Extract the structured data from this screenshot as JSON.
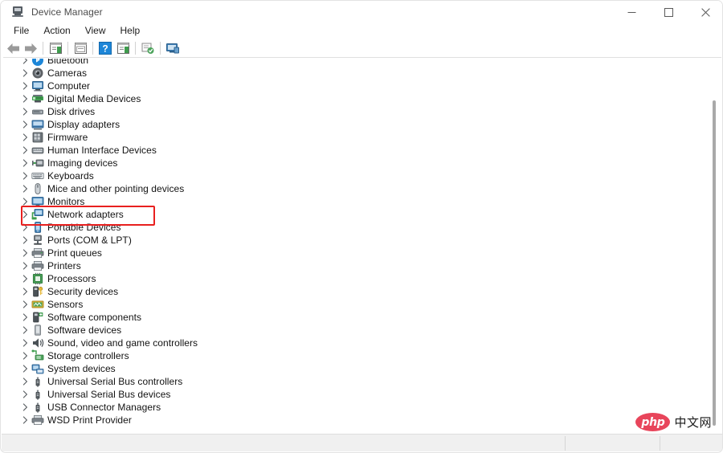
{
  "window": {
    "title": "Device Manager",
    "app_icon": "device-manager-icon",
    "caption": {
      "minimize": "minimize-icon",
      "maximize": "maximize-icon",
      "close": "close-icon"
    }
  },
  "menubar": {
    "items": [
      {
        "label": "File"
      },
      {
        "label": "Action"
      },
      {
        "label": "View"
      },
      {
        "label": "Help"
      }
    ]
  },
  "toolbar": {
    "buttons": [
      {
        "name": "back-button",
        "icon": "back-arrow-icon"
      },
      {
        "name": "forward-button",
        "icon": "forward-arrow-icon"
      },
      {
        "name": "separator-1",
        "icon": "separator"
      },
      {
        "name": "show-hide-console-tree-button",
        "icon": "console-tree-icon"
      },
      {
        "name": "separator-2",
        "icon": "separator"
      },
      {
        "name": "properties-button",
        "icon": "properties-icon"
      },
      {
        "name": "separator-3",
        "icon": "separator"
      },
      {
        "name": "help-button",
        "icon": "help-question-icon"
      },
      {
        "name": "scan-for-hardware-changes-button",
        "icon": "scan-hardware-icon"
      },
      {
        "name": "separator-4",
        "icon": "separator"
      },
      {
        "name": "update-driver-button",
        "icon": "update-driver-icon"
      },
      {
        "name": "separator-5",
        "icon": "separator"
      },
      {
        "name": "device-display-button",
        "icon": "device-monitor-icon"
      }
    ]
  },
  "tree": {
    "items": [
      {
        "label": "Bluetooth",
        "icon": "bluetooth-icon",
        "expanded": false,
        "highlighted": false
      },
      {
        "label": "Cameras",
        "icon": "camera-icon",
        "expanded": false,
        "highlighted": false
      },
      {
        "label": "Computer",
        "icon": "computer-icon",
        "expanded": false,
        "highlighted": false
      },
      {
        "label": "Digital Media Devices",
        "icon": "digital-media-icon",
        "expanded": false,
        "highlighted": false
      },
      {
        "label": "Disk drives",
        "icon": "disk-drive-icon",
        "expanded": false,
        "highlighted": false
      },
      {
        "label": "Display adapters",
        "icon": "display-adapter-icon",
        "expanded": false,
        "highlighted": false
      },
      {
        "label": "Firmware",
        "icon": "firmware-icon",
        "expanded": false,
        "highlighted": false
      },
      {
        "label": "Human Interface Devices",
        "icon": "hid-icon",
        "expanded": false,
        "highlighted": true
      },
      {
        "label": "Imaging devices",
        "icon": "imaging-device-icon",
        "expanded": false,
        "highlighted": false
      },
      {
        "label": "Keyboards",
        "icon": "keyboard-icon",
        "expanded": false,
        "highlighted": false
      },
      {
        "label": "Mice and other pointing devices",
        "icon": "mouse-icon",
        "expanded": false,
        "highlighted": false
      },
      {
        "label": "Monitors",
        "icon": "monitor-icon",
        "expanded": false,
        "highlighted": false
      },
      {
        "label": "Network adapters",
        "icon": "network-adapter-icon",
        "expanded": false,
        "highlighted": false
      },
      {
        "label": "Portable Devices",
        "icon": "portable-device-icon",
        "expanded": false,
        "highlighted": false
      },
      {
        "label": "Ports (COM & LPT)",
        "icon": "port-icon",
        "expanded": false,
        "highlighted": false
      },
      {
        "label": "Print queues",
        "icon": "print-queue-icon",
        "expanded": false,
        "highlighted": false
      },
      {
        "label": "Printers",
        "icon": "printer-icon",
        "expanded": false,
        "highlighted": false
      },
      {
        "label": "Processors",
        "icon": "processor-icon",
        "expanded": false,
        "highlighted": false
      },
      {
        "label": "Security devices",
        "icon": "security-device-icon",
        "expanded": false,
        "highlighted": false
      },
      {
        "label": "Sensors",
        "icon": "sensor-icon",
        "expanded": false,
        "highlighted": false
      },
      {
        "label": "Software components",
        "icon": "software-component-icon",
        "expanded": false,
        "highlighted": false
      },
      {
        "label": "Software devices",
        "icon": "software-device-icon",
        "expanded": false,
        "highlighted": false
      },
      {
        "label": "Sound, video and game controllers",
        "icon": "sound-controller-icon",
        "expanded": false,
        "highlighted": false
      },
      {
        "label": "Storage controllers",
        "icon": "storage-controller-icon",
        "expanded": false,
        "highlighted": false
      },
      {
        "label": "System devices",
        "icon": "system-device-icon",
        "expanded": false,
        "highlighted": false
      },
      {
        "label": "Universal Serial Bus controllers",
        "icon": "usb-icon",
        "expanded": false,
        "highlighted": false
      },
      {
        "label": "Universal Serial Bus devices",
        "icon": "usb-icon",
        "expanded": false,
        "highlighted": false
      },
      {
        "label": "USB Connector Managers",
        "icon": "usb-icon",
        "expanded": false,
        "highlighted": false
      },
      {
        "label": "WSD Print Provider",
        "icon": "printer-icon",
        "expanded": false,
        "highlighted": false
      }
    ]
  },
  "statusbar": {
    "panels": [
      "",
      "",
      ""
    ]
  },
  "watermark": {
    "badge": "php",
    "text": "中文网"
  },
  "colors": {
    "highlight_border": "#e8201f",
    "accent_blue": "#1d86d8",
    "accent_green": "#3f9d4e",
    "watermark_red": "#e8455b",
    "text": "#131313"
  }
}
